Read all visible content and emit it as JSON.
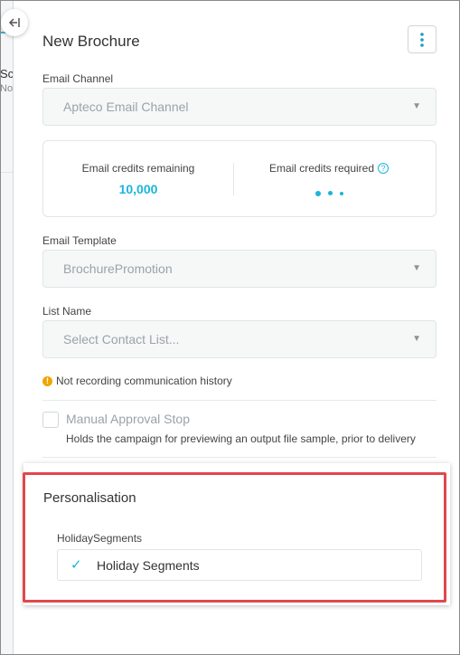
{
  "background": {
    "partial_text_1": "Sch",
    "partial_text_2": "No"
  },
  "collapse_icon": "collapse-left-icon",
  "panel": {
    "title": "New Brochure",
    "menu_icon": "kebab-menu-icon"
  },
  "email_channel": {
    "label": "Email Channel",
    "value": "Apteco Email Channel"
  },
  "credits": {
    "remaining_label": "Email credits remaining",
    "remaining_value": "10,000",
    "required_label": "Email credits required",
    "help_glyph": "?"
  },
  "email_template": {
    "label": "Email Template",
    "value": "BrochurePromotion"
  },
  "list_name": {
    "label": "List Name",
    "placeholder": "Select Contact List..."
  },
  "history_notice": {
    "icon_glyph": "!",
    "text": "Not recording communication history"
  },
  "manual_approval": {
    "label": "Manual Approval Stop",
    "description": "Holds the campaign for previewing an output file sample, prior to delivery"
  },
  "personalisation": {
    "title": "Personalisation",
    "field_label": "HolidaySegments",
    "value": "Holiday Segments"
  },
  "colors": {
    "accent": "#1ab5d9",
    "highlight_border": "#e0484d",
    "warning": "#f0a500"
  }
}
